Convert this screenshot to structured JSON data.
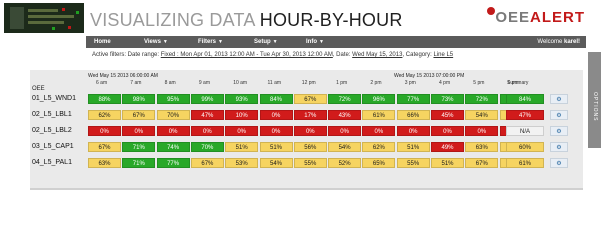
{
  "header": {
    "title_part1": "VISUALIZING DATA ",
    "title_part2": "HOUR-BY-HOUR",
    "brand_part1": "OEE",
    "brand_part2": "ALERT"
  },
  "nav": {
    "items": [
      "Home",
      "Views",
      "Filters",
      "Setup",
      "Info"
    ],
    "welcome_prefix": "Welcome ",
    "welcome_user": "karel!"
  },
  "filters": {
    "label": "Active filters: Date range: ",
    "date_range": "Fixed : Mon Apr 01, 2013 12:00 AM - Tue Apr 30, 2013 12:00 AM",
    "date_label": ", Date: ",
    "date": "Wed May 15, 2013",
    "category_label": ", Category: ",
    "category": "Line L5"
  },
  "side_tab": {
    "label": "OPTIONS"
  },
  "grid": {
    "start_time": "Wed May 15 2013 06:00:00 AM",
    "end_time": "Wed May 15 2013 07:00:00 PM",
    "oee_label": "OEE",
    "summary_label": "Summary",
    "hours": [
      "6 am",
      "7 am",
      "8 am",
      "9 am",
      "10 am",
      "11 am",
      "12 pm",
      "1 pm",
      "2 pm",
      "3 pm",
      "4 pm",
      "5 pm",
      "6 pm"
    ],
    "rows": [
      {
        "label": "01_L5_WND1",
        "values": [
          "88%",
          "98%",
          "95%",
          "99%",
          "93%",
          "84%",
          "67%",
          "72%",
          "96%",
          "77%",
          "73%",
          "72%",
          "75%"
        ],
        "status": [
          "g",
          "g",
          "g",
          "g",
          "g",
          "g",
          "y",
          "g",
          "g",
          "g",
          "g",
          "g",
          "g"
        ],
        "summary": "84%",
        "summary_status": "g"
      },
      {
        "label": "02_L5_LBL1",
        "values": [
          "62%",
          "67%",
          "70%",
          "47%",
          "10%",
          "0%",
          "17%",
          "43%",
          "61%",
          "66%",
          "45%",
          "54%",
          "65%"
        ],
        "status": [
          "y",
          "y",
          "y",
          "r",
          "r",
          "r",
          "r",
          "r",
          "y",
          "y",
          "r",
          "y",
          "y"
        ],
        "summary": "47%",
        "summary_status": "r"
      },
      {
        "label": "02_L5_LBL2",
        "values": [
          "0%",
          "0%",
          "0%",
          "0%",
          "0%",
          "0%",
          "0%",
          "0%",
          "0%",
          "0%",
          "0%",
          "0%",
          "0%"
        ],
        "status": [
          "r",
          "r",
          "r",
          "r",
          "r",
          "r",
          "r",
          "r",
          "r",
          "r",
          "r",
          "r",
          "r"
        ],
        "summary": "N/A",
        "summary_status": "n"
      },
      {
        "label": "03_L5_CAP1",
        "values": [
          "67%",
          "71%",
          "74%",
          "70%",
          "51%",
          "51%",
          "56%",
          "54%",
          "62%",
          "51%",
          "49%",
          "63%",
          "60%"
        ],
        "status": [
          "y",
          "g",
          "g",
          "g",
          "y",
          "y",
          "y",
          "y",
          "y",
          "y",
          "r",
          "y",
          "y"
        ],
        "summary": "60%",
        "summary_status": "y"
      },
      {
        "label": "04_L5_PAL1",
        "values": [
          "63%",
          "71%",
          "77%",
          "67%",
          "53%",
          "54%",
          "55%",
          "52%",
          "65%",
          "55%",
          "51%",
          "67%",
          "58%"
        ],
        "status": [
          "y",
          "g",
          "g",
          "y",
          "y",
          "y",
          "y",
          "y",
          "y",
          "y",
          "y",
          "y",
          "y"
        ],
        "summary": "61%",
        "summary_status": "y"
      }
    ]
  },
  "colors": {
    "green": "#28a828",
    "yellow": "#f6d461",
    "red": "#d11b1b",
    "nav": "#5b5b5b",
    "brand_red": "#c21a1a"
  },
  "icons": {
    "row_action": "gear-icon",
    "brand_mark": "brand-dot-icon"
  }
}
